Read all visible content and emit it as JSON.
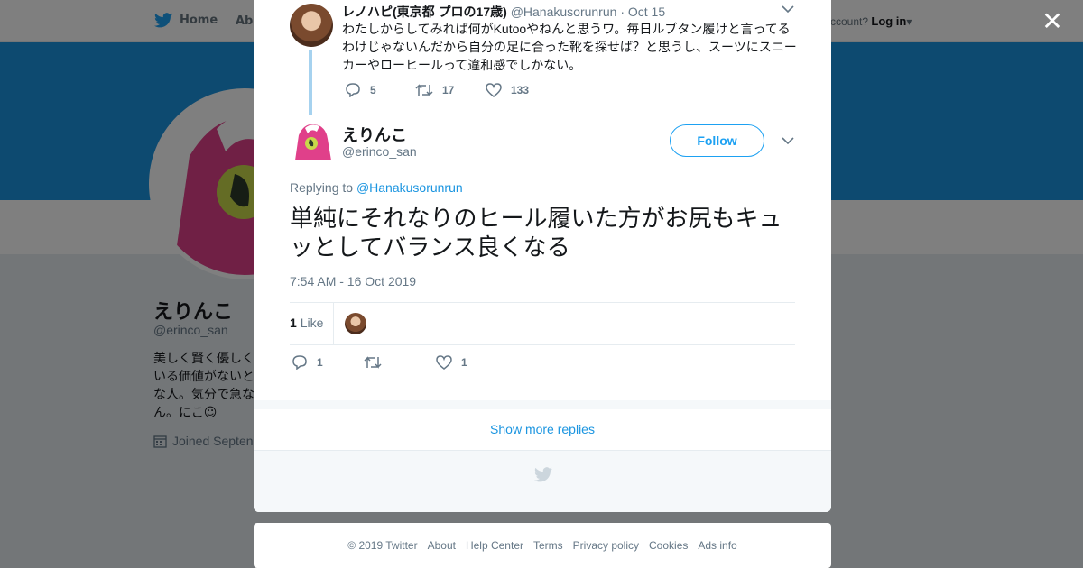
{
  "topbar": {
    "home_label": "Home",
    "about_label": "Abo",
    "account_prompt": "ccount?",
    "login_label": "Log in"
  },
  "profile": {
    "name": "えりんこ",
    "handle": "@erinco_san",
    "bio": "美しく賢く優しく いる価値がないと な人。気分で急な ん。にこ☺",
    "joined": "Joined Septen"
  },
  "parent_tweet": {
    "name": "レノハピ(東京都 プロの17歳)",
    "handle": "@Hanakusorunrun",
    "date": "Oct 15",
    "text": "わたしからしてみれば何がKutooやねんと思うワ。毎日ルブタン履けと言ってるわけじゃないんだから自分の足に合った靴を探せば？と思うし、スーツにスニーカーやローヒールって違和感でしかない。",
    "replies": "5",
    "retweets": "17",
    "likes": "133"
  },
  "main_tweet": {
    "name": "えりんこ",
    "handle": "@erinco_san",
    "follow_label": "Follow",
    "replying_prefix": "Replying to",
    "replying_to": "@Hanakusorunrun",
    "text": "単純にそれなりのヒール履いた方がお尻もキュッとしてバランス良くなる",
    "timestamp": "7:54 AM - 16 Oct 2019",
    "like_count": "1",
    "like_label": "Like",
    "replies": "1",
    "retweets": "",
    "likes": "1"
  },
  "show_more_label": "Show more replies",
  "footer": {
    "copyright": "© 2019 Twitter",
    "links": [
      "About",
      "Help Center",
      "Terms",
      "Privacy policy",
      "Cookies",
      "Ads info"
    ]
  },
  "colors": {
    "brand": "#1da1f2",
    "link": "#1b95e0",
    "banner": "#1b95e0",
    "thread_line": "#a6d2ef",
    "avatar_pink": "#e0408a"
  },
  "icons": {
    "logo": "twitter-bird-icon",
    "close": "close-icon",
    "reply": "reply-icon",
    "retweet": "retweet-icon",
    "like": "heart-icon",
    "chevron": "chevron-down-icon",
    "calendar": "calendar-icon"
  }
}
